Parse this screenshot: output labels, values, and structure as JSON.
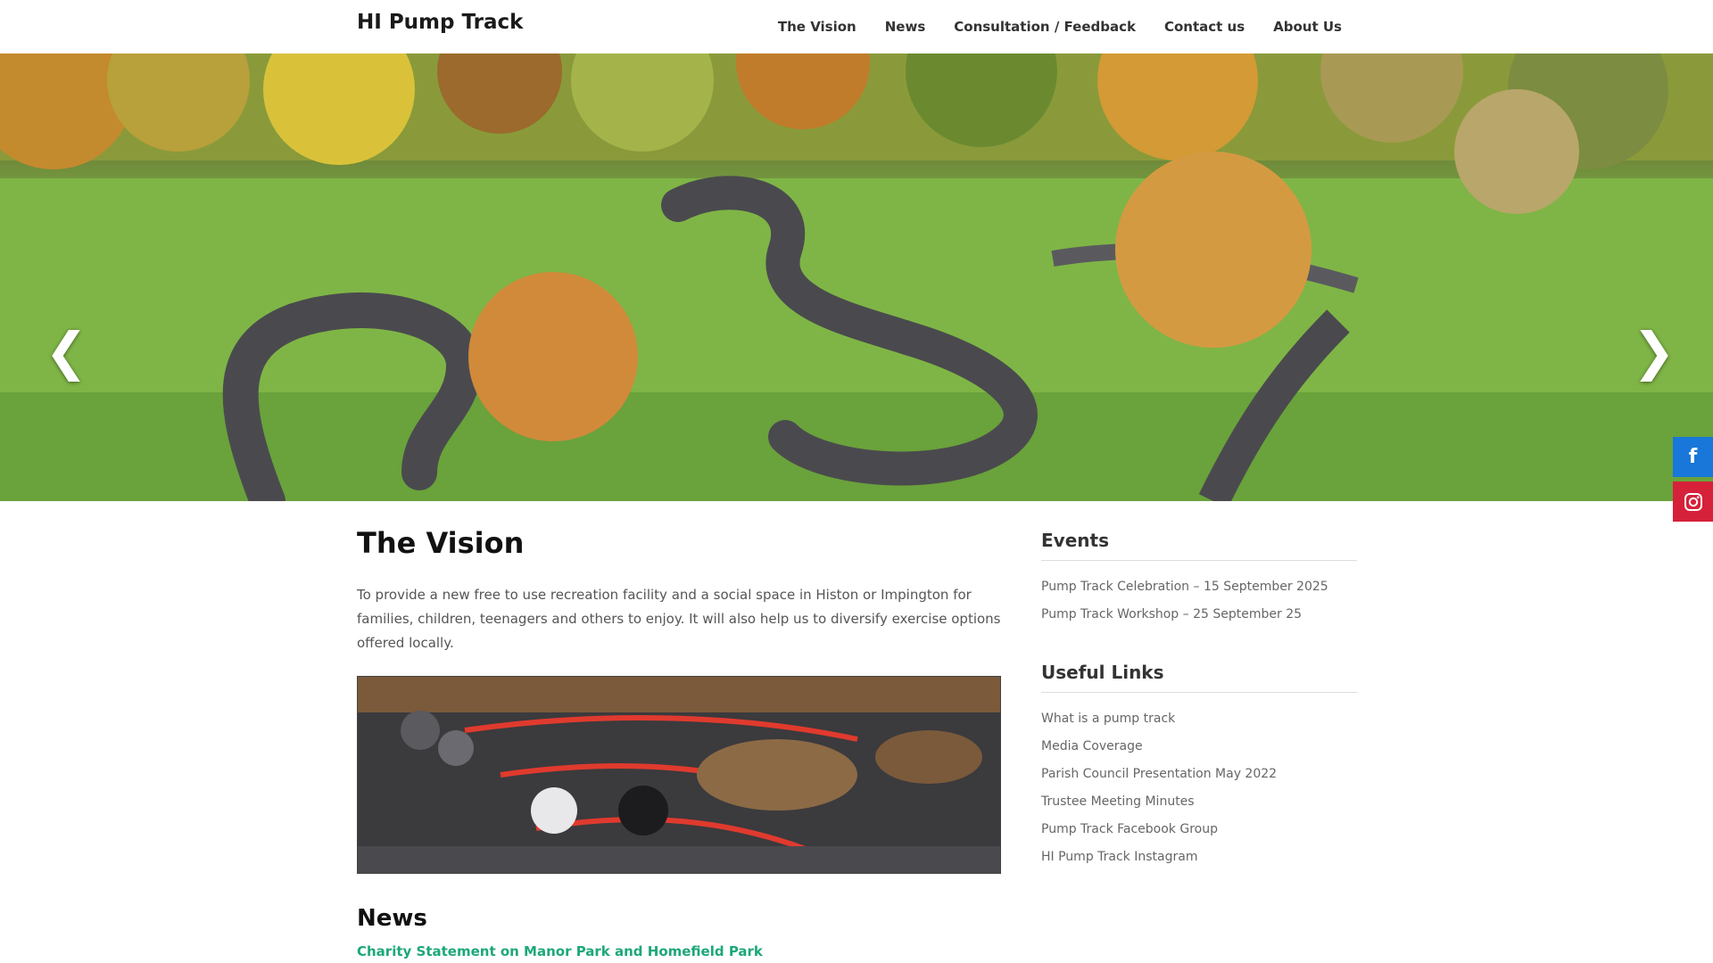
{
  "header": {
    "site_title": "HI Pump Track",
    "nav": [
      "The Vision",
      "News",
      "Consultation / Feedback",
      "Contact us",
      "About Us"
    ]
  },
  "hero": {
    "prev_arrow": "❮",
    "next_arrow": "❯"
  },
  "social": {
    "facebook_glyph": "f"
  },
  "main": {
    "title": "The Vision",
    "intro": "To provide a new free to use recreation facility and a social space in Histon or Impington for families, children, teenagers and others to enjoy. It will also help us to diversify exercise options offered locally.",
    "news_heading": "News",
    "news_link": "Charity Statement on Manor Park and Homefield Park"
  },
  "sidebar": {
    "events": {
      "title": "Events",
      "items": [
        "Pump Track Celebration – 15 September 2025",
        "Pump Track Workshop – 25 September 25"
      ]
    },
    "links": {
      "title": "Useful Links",
      "items": [
        "What is a pump track",
        "Media Coverage",
        "Parish Council Presentation May 2022",
        "Trustee Meeting Minutes",
        "Pump Track Facebook Group",
        "HI Pump Track Instagram"
      ]
    }
  },
  "colors": {
    "accent_link": "#1da878",
    "facebook": "#1877d8",
    "instagram": "#d6213a"
  }
}
